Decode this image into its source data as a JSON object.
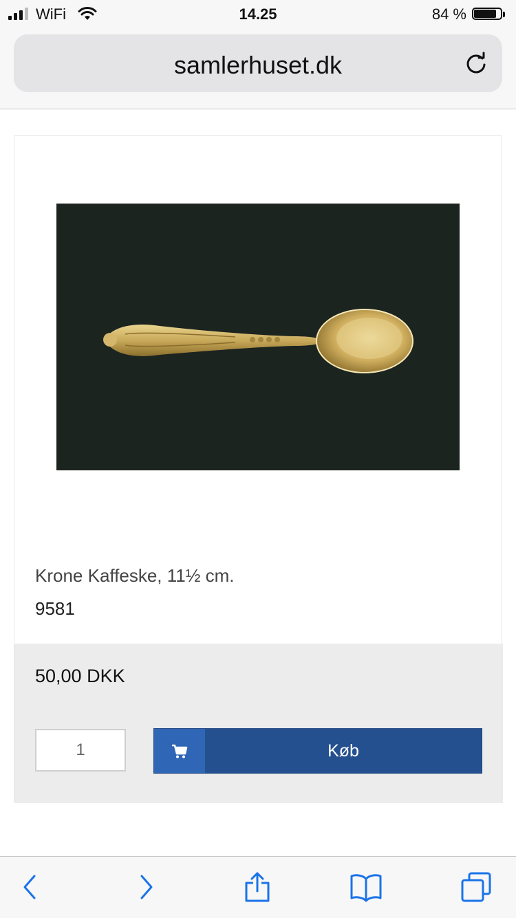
{
  "status_bar": {
    "carrier": "WiFi",
    "time": "14.25",
    "battery_percent": "84 %",
    "battery_level": 0.84,
    "signal_bars_active": 3,
    "signal_bars_total": 4
  },
  "browser": {
    "url": "samlerhuset.dk",
    "reload_icon": "reload-icon"
  },
  "product": {
    "image_icon": "gold-coffee-spoon",
    "name": "Krone Kaffeske, 11½ cm.",
    "number": "9581",
    "price": "50,00 DKK",
    "quantity": "1",
    "buy_label": "Køb",
    "cart_icon": "cart-icon"
  },
  "toolbar": {
    "icons": [
      "back-icon",
      "forward-icon",
      "share-icon",
      "bookmarks-icon",
      "tabs-icon"
    ]
  },
  "colors": {
    "accent": "#25508f",
    "accent_light": "#2f66b5",
    "toolbar_icon": "#1a73e8",
    "panel_bg": "#ececec"
  }
}
